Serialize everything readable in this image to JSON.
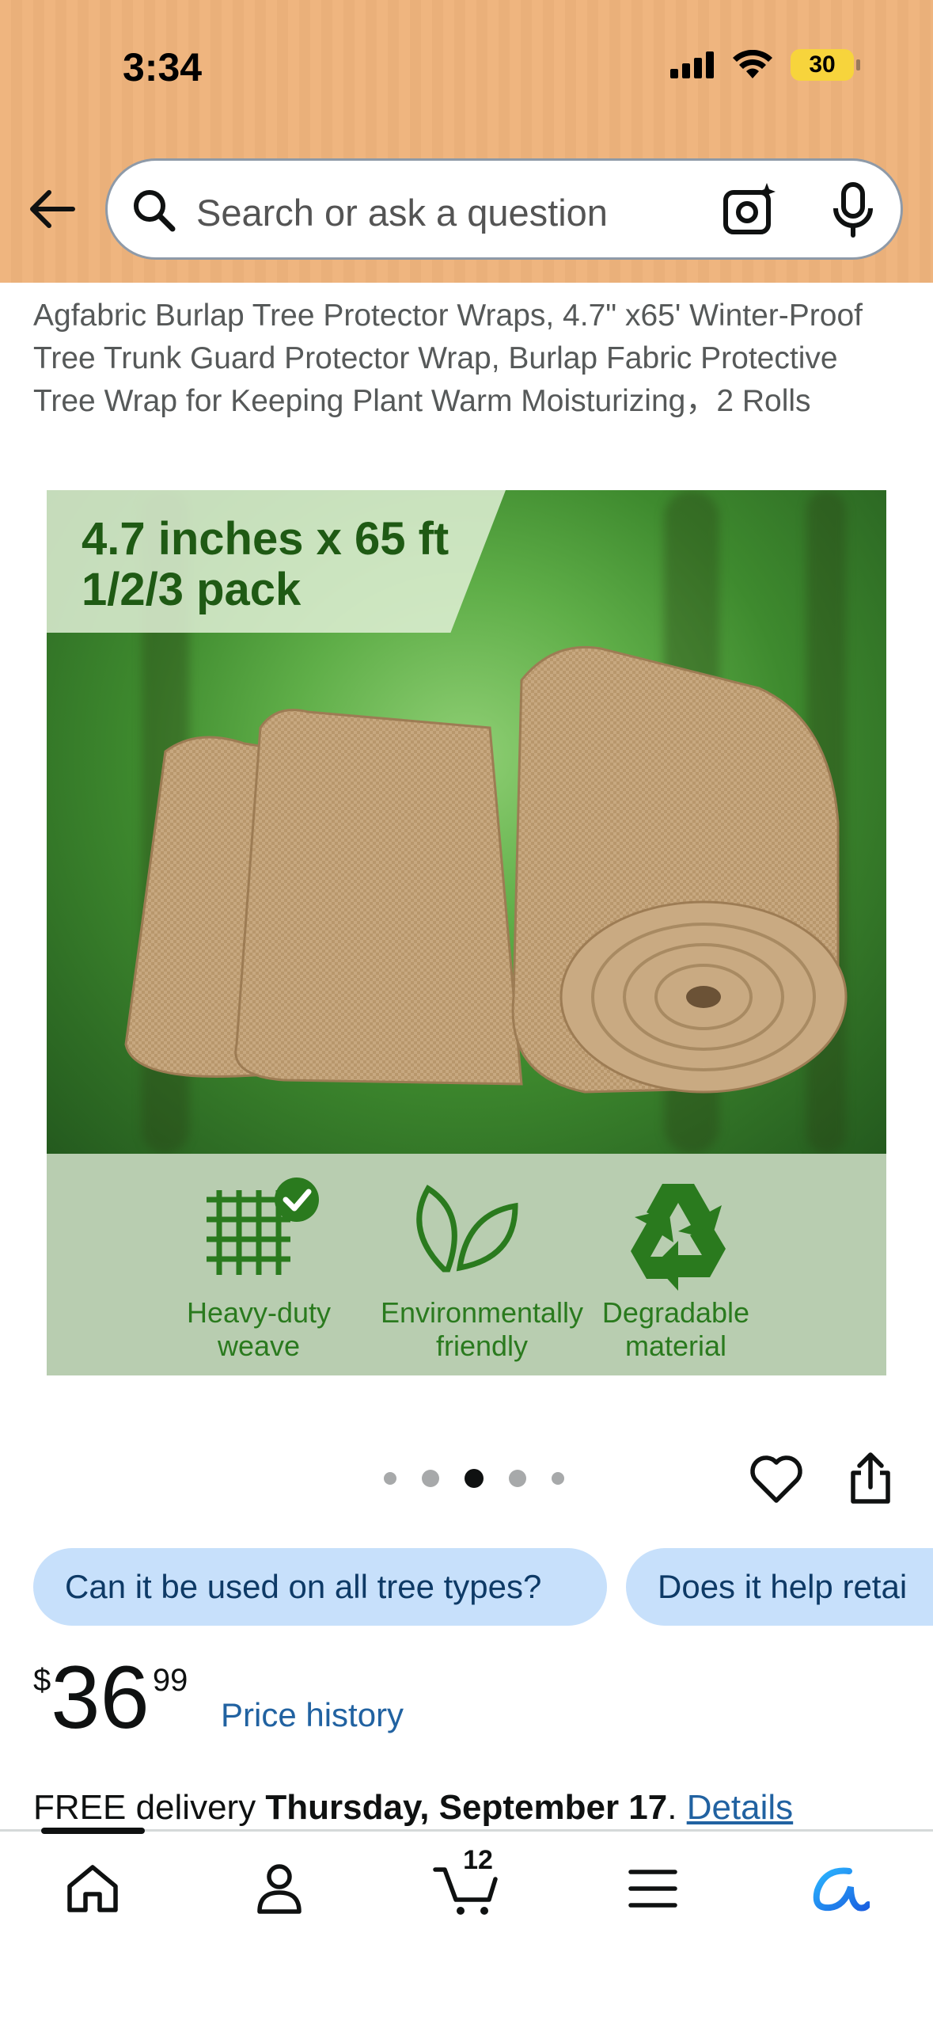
{
  "status_bar": {
    "time": "3:34",
    "battery": "30"
  },
  "search": {
    "placeholder": "Search or ask a question"
  },
  "product": {
    "title": "Agfabric Burlap Tree Protector Wraps, 4.7\" x65' Winter-Proof Tree Trunk Guard Protector Wrap, Burlap Fabric Protective Tree Wrap for Keeping Plant Warm Moisturizing，2 Rolls",
    "image": {
      "banner_line1": "4.7 inches x 65 ft",
      "banner_line2": "1/2/3 pack",
      "features": [
        {
          "line1": "Heavy-duty",
          "line2": "weave",
          "icon": "grid-check-icon"
        },
        {
          "line1": "Environmentally",
          "line2": "friendly",
          "icon": "leaf-icon"
        },
        {
          "line1": "Degradable",
          "line2": "material",
          "icon": "recycle-icon"
        }
      ]
    },
    "carousel": {
      "count": 5,
      "active_index": 2
    }
  },
  "questions": [
    "Can it be used on all tree types?",
    "Does it help retai"
  ],
  "price": {
    "symbol": "$",
    "whole": "36",
    "fraction": "99",
    "history_label": "Price history"
  },
  "delivery": {
    "prefix": "FREE delivery",
    "date": "Thursday, September 17",
    "suffix": ". ",
    "link": "Details"
  },
  "bottom_nav": {
    "items": [
      "home-icon",
      "account-icon",
      "cart-icon",
      "menu-icon",
      "rufus-icon"
    ],
    "cart_count": "12"
  },
  "colors": {
    "header": "#efb57f",
    "chip": "#c7e0fb",
    "link": "#2162a1",
    "feature_green": "#2a7a1e"
  }
}
